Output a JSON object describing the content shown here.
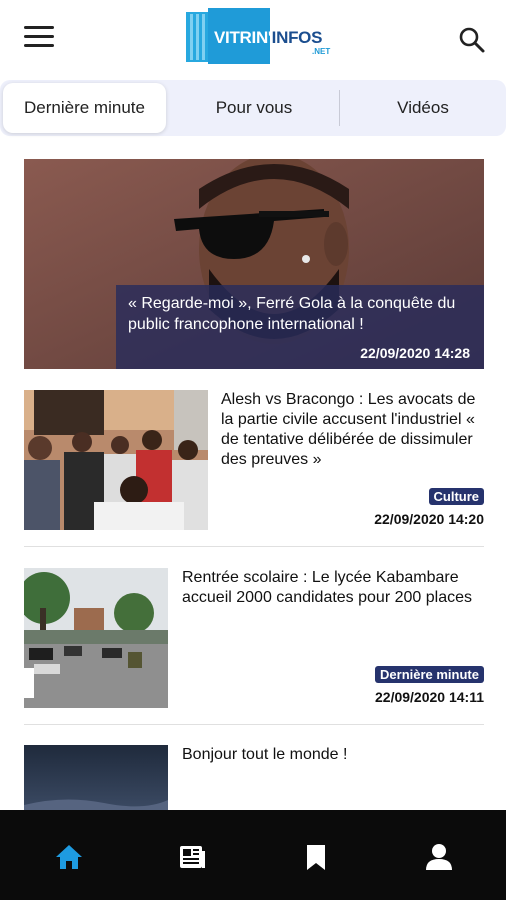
{
  "header": {
    "logo_part1": "VITRIN'",
    "logo_part2": "INFOS",
    "logo_sub": ".NET",
    "menu_icon": "hamburger-menu-icon",
    "search_icon": "search-icon"
  },
  "tabs": [
    {
      "label": "Dernière minute",
      "active": true
    },
    {
      "label": "Pour vous",
      "active": false
    },
    {
      "label": "Vidéos",
      "active": false
    }
  ],
  "hero": {
    "title": "« Regarde-moi », Ferré Gola à la conquête du public francophone international !",
    "date": "22/09/2020 14:28"
  },
  "articles": [
    {
      "title": "Alesh vs Bracongo : Les avocats de la partie civile accusent l'industriel « de tentative délibérée de dissimuler des preuves »",
      "category": "Culture",
      "date": "22/09/2020 14:20"
    },
    {
      "title": "Rentrée scolaire : Le lycée Kabambare accueil 2000 candidates pour 200 places",
      "category": "Dernière minute",
      "date": "22/09/2020 14:11"
    },
    {
      "title": "Bonjour tout le monde !",
      "category": "",
      "date": ""
    }
  ],
  "bottom_nav": {
    "items": [
      "home-icon",
      "newspaper-icon",
      "bookmark-icon",
      "user-icon"
    ],
    "active_color": "#1e9be0",
    "inactive_color": "#ffffff"
  },
  "colors": {
    "badge_bg": "#26336d",
    "tab_bar_bg": "#eef0fb",
    "logo_blue": "#1e9ad6",
    "logo_dark": "#1b4e8f"
  }
}
